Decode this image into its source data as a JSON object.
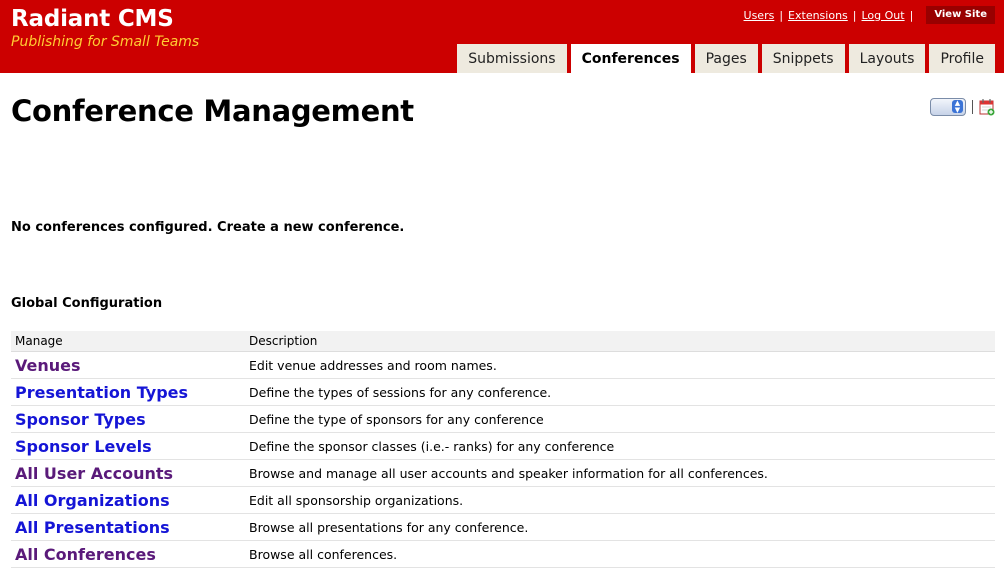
{
  "app": {
    "title": "Radiant CMS",
    "subtitle": "Publishing for Small Teams"
  },
  "toplinks": {
    "users": "Users",
    "extensions": "Extensions",
    "logout": "Log Out",
    "separator": "|",
    "view_site": "View Site"
  },
  "tabs": [
    {
      "label": "Submissions",
      "active": false
    },
    {
      "label": "Conferences",
      "active": true
    },
    {
      "label": "Pages",
      "active": false
    },
    {
      "label": "Snippets",
      "active": false
    },
    {
      "label": "Layouts",
      "active": false
    },
    {
      "label": "Profile",
      "active": false
    }
  ],
  "page": {
    "title": "Conference Management",
    "notice": "No conferences configured. Create a new conference.",
    "section_title": "Global Configuration"
  },
  "table": {
    "headers": {
      "manage": "Manage",
      "description": "Description"
    },
    "rows": [
      {
        "name": "Venues",
        "description": "Edit venue addresses and room names.",
        "color": "#5a1a7a"
      },
      {
        "name": "Presentation Types",
        "description": "Define the types of sessions for any conference.",
        "color": "#1515d6"
      },
      {
        "name": "Sponsor Types",
        "description": "Define the type of sponsors for any conference",
        "color": "#1515d6"
      },
      {
        "name": "Sponsor Levels",
        "description": "Define the sponsor classes (i.e.- ranks) for any conference",
        "color": "#1515d6"
      },
      {
        "name": "All User Accounts",
        "description": "Browse and manage all user accounts and speaker information for all conferences.",
        "color": "#5a1a7a"
      },
      {
        "name": "All Organizations",
        "description": "Edit all sponsorship organizations.",
        "color": "#1515d6"
      },
      {
        "name": "All Presentations",
        "description": "Browse all presentations for any conference.",
        "color": "#1515d6"
      },
      {
        "name": "All Conferences",
        "description": "Browse all conferences.",
        "color": "#5a1a7a"
      }
    ]
  },
  "colors": {
    "header_bg": "#cc0000",
    "subtitle": "#ffcc33",
    "tab_bg": "#eeeadf",
    "link_visited": "#5a1a7a",
    "link": "#1515d6"
  },
  "icons": {
    "select": "select-dropdown-icon",
    "calendar": "calendar-add-icon"
  }
}
